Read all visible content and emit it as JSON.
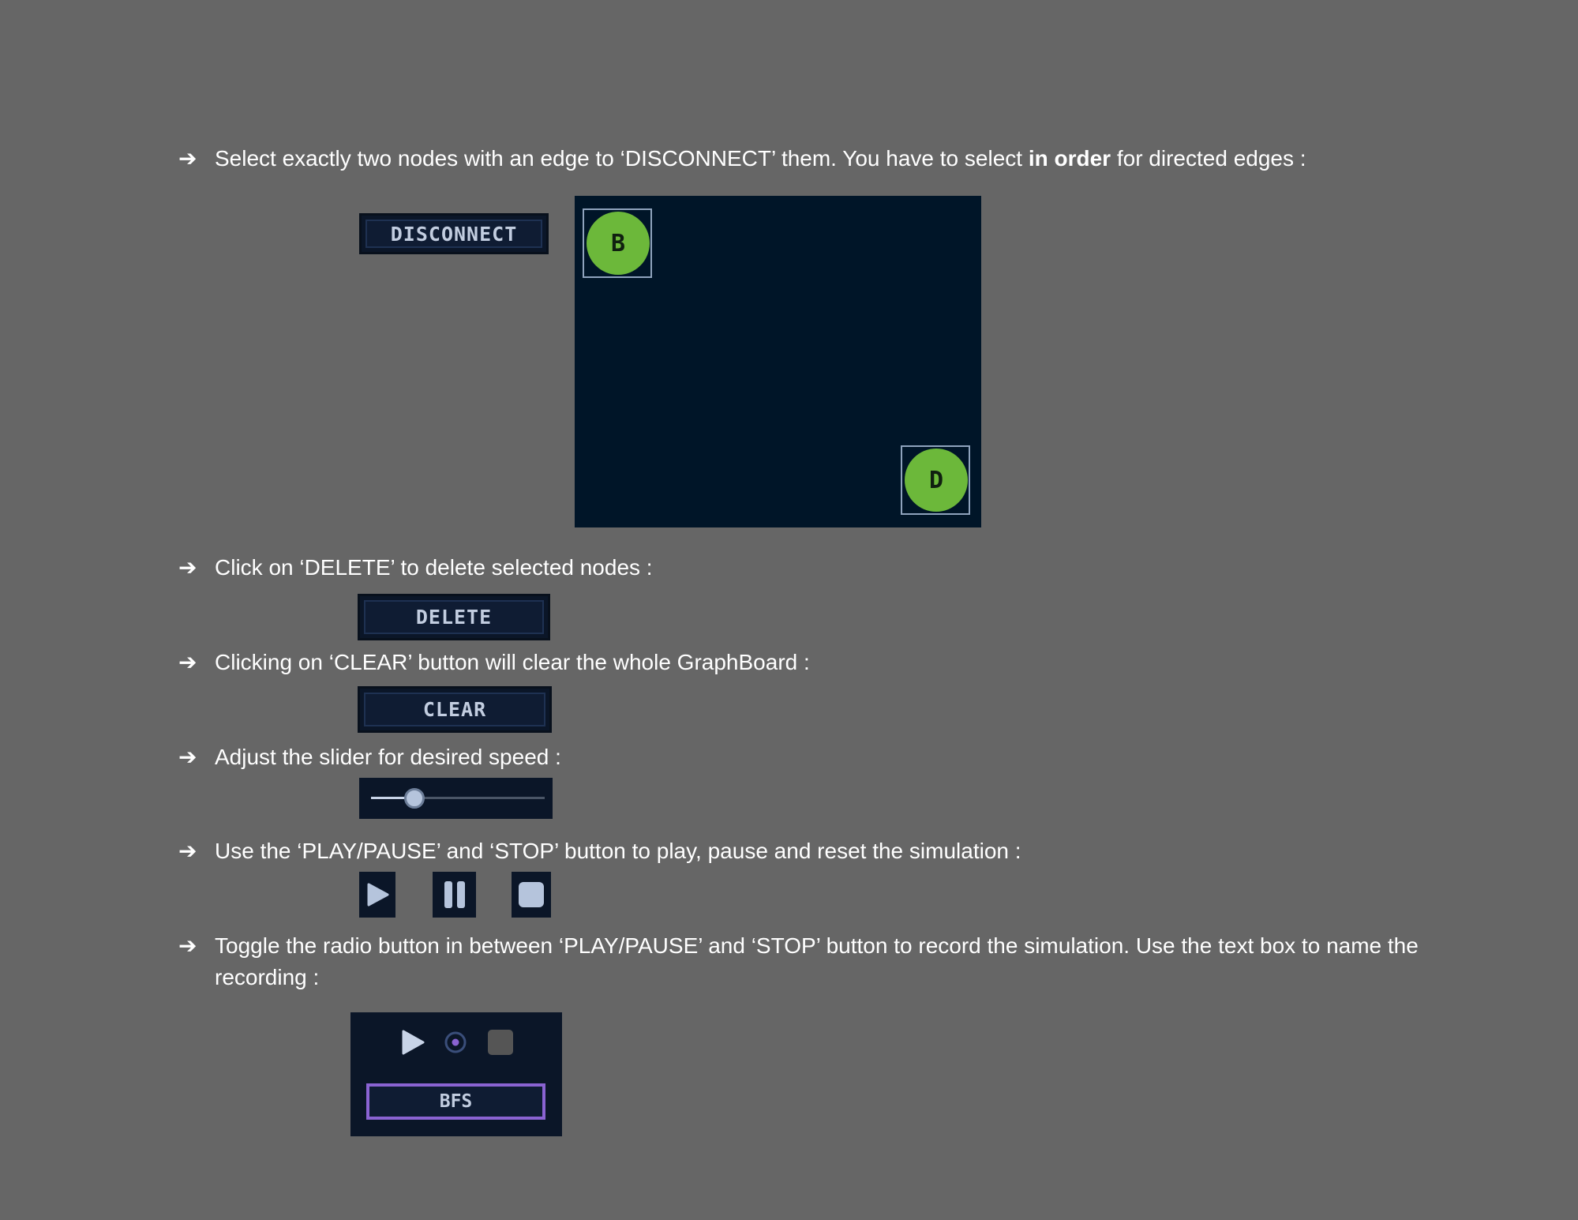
{
  "instructions": {
    "arrow": "➔",
    "disconnect": {
      "before": "Select exactly two nodes with an edge to ‘DISCONNECT’ them. You have to select ",
      "bold": "in order",
      "after": " for directed edges :"
    },
    "delete": "Click on ‘DELETE’ to delete selected nodes :",
    "clear": "Clicking on ‘CLEAR’ button will clear the whole GraphBoard :",
    "slider": "Adjust the slider for desired speed :",
    "playback": "Use the ‘PLAY/PAUSE’ and ‘STOP’ button to play, pause and reset the simulation :",
    "record": "Toggle the radio button in between ‘PLAY/PAUSE’ and ‘STOP’ button to record the simulation. Use the text box to name the recording :"
  },
  "buttons": {
    "disconnect": "DISCONNECT",
    "delete": "DELETE",
    "clear": "CLEAR"
  },
  "graph": {
    "nodes": [
      {
        "label": "B",
        "selected": true
      },
      {
        "label": "D",
        "selected": true
      }
    ]
  },
  "speed_slider": {
    "value_fraction": 0.25
  },
  "controls": {
    "icons": [
      "play-icon",
      "pause-icon",
      "stop-icon"
    ]
  },
  "recorder": {
    "icons": [
      "play-icon",
      "record-radio-icon",
      "stop-icon"
    ],
    "recording_name": "BFS"
  },
  "colors": {
    "background": "#666666",
    "panel": "#0b1628",
    "board": "#001528",
    "node": "#6cb83a",
    "accent_purple": "#8a63d2"
  }
}
